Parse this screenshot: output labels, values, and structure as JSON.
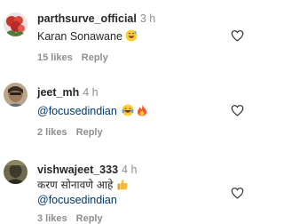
{
  "comments": [
    {
      "username": "parthsurve_official",
      "time": "3 h",
      "text": "Karan Sonawane",
      "emojis": [
        "grinning-face-with-sweat-icon"
      ],
      "likes": "15 likes",
      "reply": "Reply"
    },
    {
      "username": "jeet_mh",
      "time": "4 h",
      "mention": "@focusedindian",
      "emojis": [
        "tears-of-joy-icon",
        "fire-icon"
      ],
      "likes": "2 likes",
      "reply": "Reply"
    },
    {
      "username": "vishwajeet_333",
      "time": "4 h",
      "text": "करण सोनावणे आहे",
      "mention": "@focusedindian",
      "emojis": [
        "thumbs-up-icon"
      ],
      "likes": "3 likes",
      "reply": "Reply"
    }
  ],
  "colors": {
    "text": "#262626",
    "muted": "#8e8e8e",
    "mention": "#00376b"
  }
}
